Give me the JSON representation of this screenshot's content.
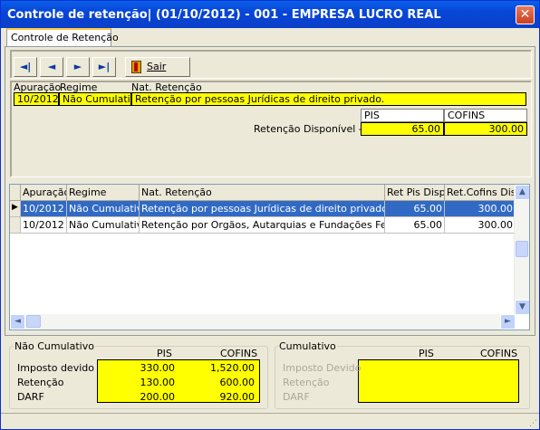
{
  "window": {
    "title": "Controle de retenção|  (01/10/2012) - 001 - EMPRESA LUCRO REAL",
    "close_label": "✕"
  },
  "tab": {
    "label": "Controle de Retenção"
  },
  "toolbar": {
    "first_icon": "◄|",
    "prev_icon": "◄",
    "next_icon": "►",
    "last_icon": "►|",
    "sair_label": "Sair"
  },
  "detail": {
    "labels": {
      "apuracao": "Apuração",
      "regime": "Regime",
      "nat": "Nat. Retenção"
    },
    "values": {
      "apuracao": "10/2012",
      "regime": "Não Cumulativo",
      "nat": "Retenção por pessoas Jurídicas de direito privado."
    },
    "disp_label": "Retenção Disponível ->",
    "pis_header": "PIS",
    "cofins_header": "COFINS",
    "pis_value": "65.00",
    "cofins_value": "300.00"
  },
  "grid": {
    "columns": [
      "Apuração",
      "Regime",
      "Nat. Retenção",
      "Ret Pis Disp.",
      "Ret.Cofins Disp"
    ],
    "rows": [
      {
        "apuracao": "10/2012",
        "regime": "Não Cumulativo",
        "nat": "Retenção por pessoas Jurídicas de direito privado.",
        "pis": "65.00",
        "cofins": "300.00"
      },
      {
        "apuracao": "10/2012",
        "regime": "Não Cumulativo",
        "nat": "Retenção por Orgãos, Autarquias e Fundações Federais",
        "pis": "65.00",
        "cofins": "300.00"
      }
    ]
  },
  "nao_cumulativo": {
    "title": "Não Cumulativo",
    "pis_header": "PIS",
    "cofins_header": "COFINS",
    "rows": [
      {
        "label": "Imposto devido",
        "pis": "330.00",
        "cofins": "1,520.00"
      },
      {
        "label": "Retenção",
        "pis": "130.00",
        "cofins": "600.00"
      },
      {
        "label": "DARF",
        "pis": "200.00",
        "cofins": "920.00"
      }
    ]
  },
  "cumulativo": {
    "title": "Cumulativo",
    "pis_header": "PIS",
    "cofins_header": "COFINS",
    "rows": [
      {
        "label": "Imposto Devido"
      },
      {
        "label": "Retenção"
      },
      {
        "label": "DARF"
      }
    ]
  }
}
